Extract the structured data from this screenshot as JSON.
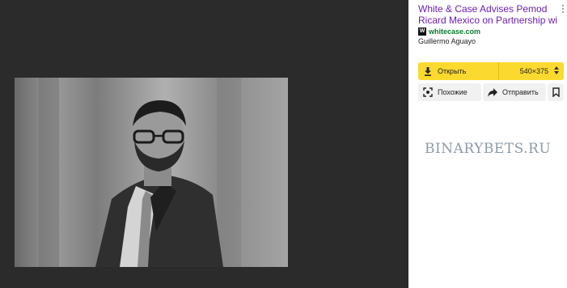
{
  "result": {
    "title_line1": "White & Case Advises Pemod",
    "title_line2": "Ricard Mexico on Partnership wit",
    "favicon_letter": "W",
    "domain": "whitecase.com",
    "author": "Guillermo Aguayo"
  },
  "actions": {
    "open_label": "Открыть",
    "size_value": "540×375",
    "similar_label": "Похожие",
    "share_label": "Отправить"
  },
  "watermark": "BINARYBETS.RU",
  "colors": {
    "title": "#6b1fb1",
    "domain": "#0a7b2e",
    "open_button": "#fcd92e",
    "viewer_bg": "#2b2b2b"
  },
  "icons": {
    "more": "more-vertical-icon",
    "download": "download-icon",
    "size_select": "up-down-arrows-icon",
    "similar": "camera-search-icon",
    "share": "share-arrow-icon",
    "save": "bookmark-icon"
  }
}
